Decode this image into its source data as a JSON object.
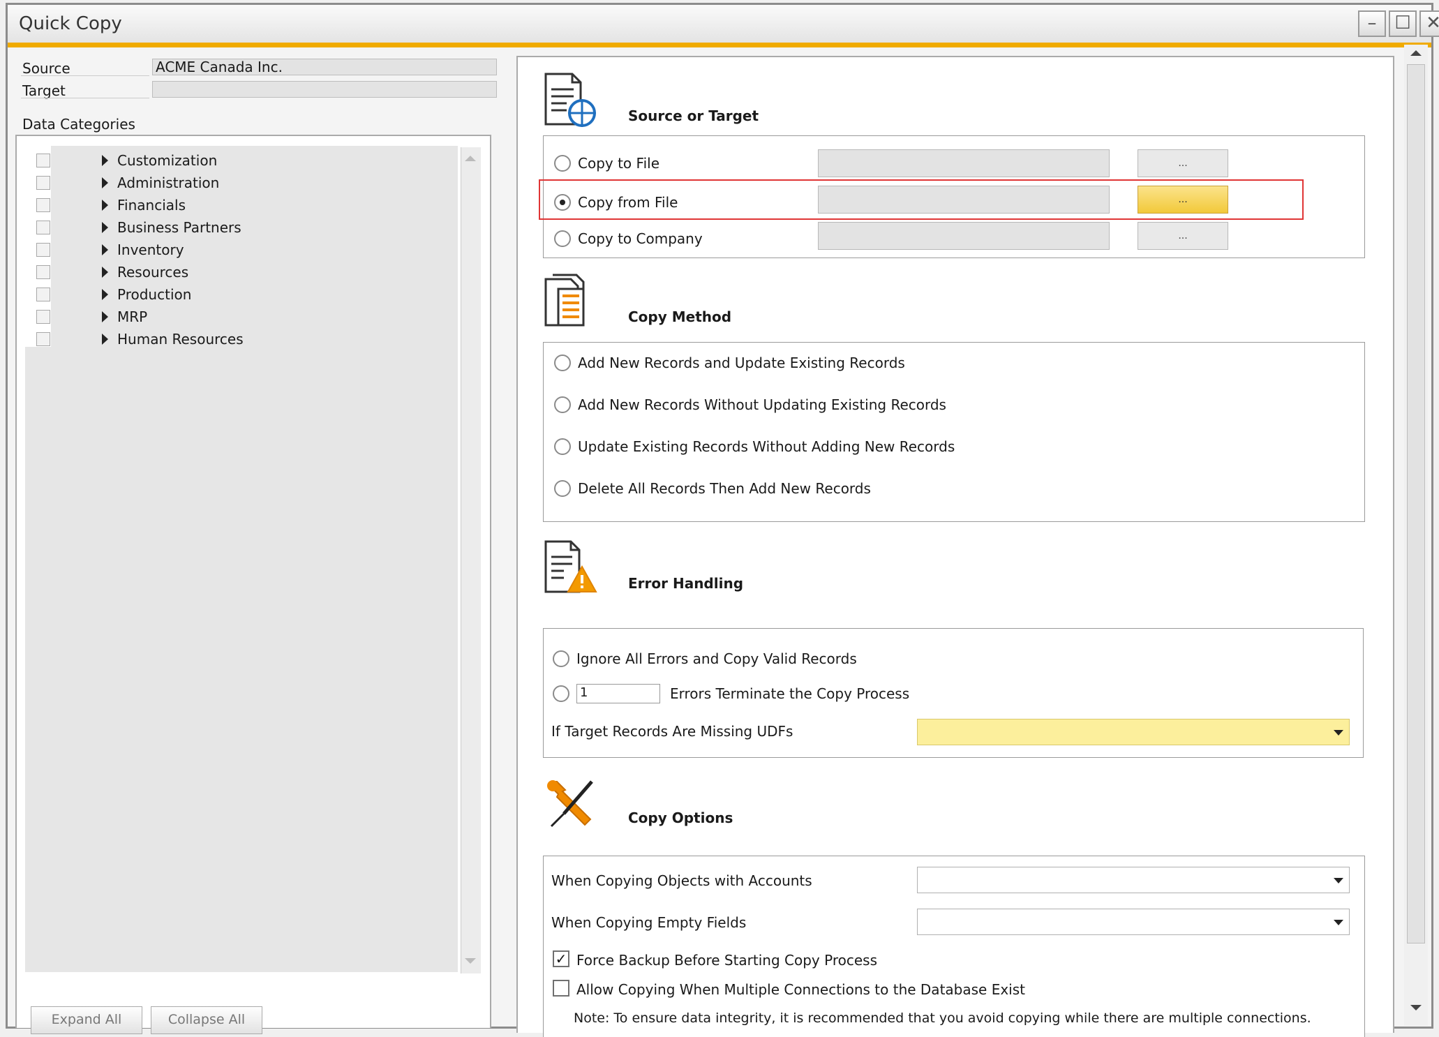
{
  "window": {
    "title": "Quick Copy",
    "min": "–",
    "max": "☐",
    "close": "✕"
  },
  "source": {
    "label": "Source",
    "value": "ACME Canada Inc."
  },
  "target": {
    "label": "Target",
    "value": ""
  },
  "categories": {
    "label": "Data Categories",
    "items": [
      "Customization",
      "Administration",
      "Financials",
      "Business Partners",
      "Inventory",
      "Resources",
      "Production",
      "MRP",
      "Human Resources"
    ]
  },
  "buttons": {
    "expand_all": "Expand All",
    "collapse_all": "Collapse All",
    "browse": "..."
  },
  "source_target": {
    "heading": "Source or Target",
    "options": [
      "Copy to File",
      "Copy from File",
      "Copy to Company"
    ],
    "selected": "Copy from File"
  },
  "copy_method": {
    "heading": "Copy Method",
    "options": [
      "Add New Records and Update Existing Records",
      "Add New Records Without Updating Existing Records",
      "Update Existing Records Without Adding New Records",
      "Delete All Records Then Add New Records"
    ]
  },
  "error_handling": {
    "heading": "Error Handling",
    "ignore_label": "Ignore All Errors and Copy Valid Records",
    "error_count": "1",
    "terminate_label": "Errors Terminate the Copy Process",
    "missing_udfs_label": "If Target Records Are Missing UDFs",
    "missing_udfs_value": ""
  },
  "copy_options": {
    "heading": "Copy Options",
    "accounts_label": "When Copying Objects with Accounts",
    "accounts_value": "",
    "empty_fields_label": "When Copying Empty Fields",
    "empty_fields_value": "",
    "force_backup_label": "Force Backup Before Starting Copy Process",
    "force_backup_checked": true,
    "allow_multi_label": "Allow Copying When Multiple Connections to the Database Exist",
    "allow_multi_checked": false,
    "note": "Note: To ensure data integrity, it is recommended that you avoid copying while there are multiple connections."
  },
  "colors": {
    "accent": "#f0ab00",
    "highlight": "#e03535",
    "active_button": "#f2c93a",
    "combo_yellow": "#fcef9c"
  },
  "icons": [
    "document-target-icon",
    "document-list-icon",
    "document-warning-icon",
    "wrench-screwdriver-icon"
  ]
}
